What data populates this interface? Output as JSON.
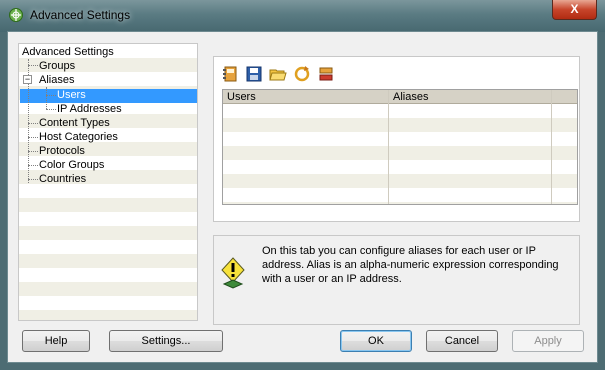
{
  "window": {
    "title": "Advanced Settings",
    "close_glyph": "X",
    "app_icon": "app-icon"
  },
  "tree": {
    "root": "Advanced Settings",
    "items": [
      {
        "label": "Groups"
      },
      {
        "label": "Aliases",
        "expanded": true,
        "expander": "−"
      },
      {
        "label": "Users",
        "selected": true
      },
      {
        "label": "IP Addresses"
      },
      {
        "label": "Content Types"
      },
      {
        "label": "Host Categories"
      },
      {
        "label": "Protocols"
      },
      {
        "label": "Color Groups"
      },
      {
        "label": "Countries"
      }
    ]
  },
  "toolbar": {
    "icons": [
      "address-book-icon",
      "save-icon",
      "open-folder-icon",
      "refresh-icon",
      "tools-icon"
    ]
  },
  "grid": {
    "columns": [
      "Users",
      "Aliases"
    ],
    "rows": []
  },
  "info": {
    "text": "On this tab you can configure aliases for each user or IP address. Alias is an alpha-numeric expression corresponding with a user or an IP address."
  },
  "buttons": {
    "help": "Help",
    "settings": "Settings...",
    "ok": "OK",
    "cancel": "Cancel",
    "apply": "Apply"
  },
  "colors": {
    "selection": "#3399ff",
    "window_frame": "#4d6c73"
  }
}
